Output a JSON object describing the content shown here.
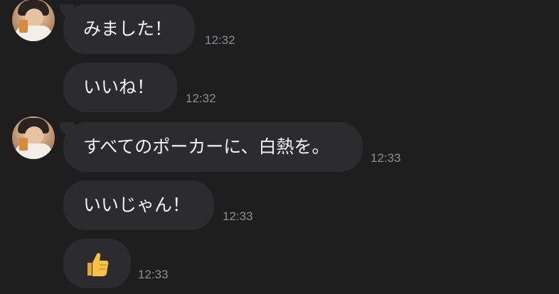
{
  "messages": [
    {
      "text": "みました！",
      "time": "12:32",
      "avatar": true
    },
    {
      "text": "いいね！",
      "time": "12:32",
      "avatar": false
    },
    {
      "text": "すべてのポーカーに、白熱を。",
      "time": "12:33",
      "avatar": true
    },
    {
      "text": "いいじゃん！",
      "time": "12:33",
      "avatar": false
    },
    {
      "emoji": "thumbs-up",
      "time": "12:33",
      "avatar": false
    }
  ],
  "colors": {
    "background": "#1e1e1f",
    "bubble": "#2c2c2e",
    "text": "#f2f2f2",
    "timestamp": "#8e8e93",
    "thumb": "#f6c144"
  }
}
